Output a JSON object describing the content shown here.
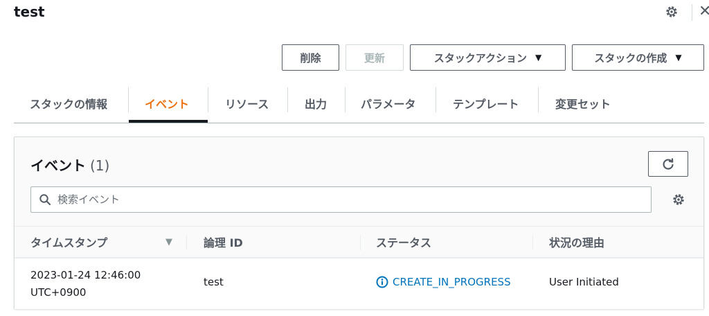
{
  "header": {
    "title": "test",
    "close_glyph": "✕"
  },
  "actions": {
    "delete": "削除",
    "update": "更新",
    "stack_actions": "スタックアクション",
    "create_stack": "スタックの作成"
  },
  "tabs": [
    {
      "label": "スタックの情報",
      "active": false
    },
    {
      "label": "イベント",
      "active": true
    },
    {
      "label": "リソース",
      "active": false
    },
    {
      "label": "出力",
      "active": false
    },
    {
      "label": "パラメータ",
      "active": false
    },
    {
      "label": "テンプレート",
      "active": false
    },
    {
      "label": "変更セット",
      "active": false
    }
  ],
  "events": {
    "title": "イベント",
    "count": "(1)",
    "search_placeholder": "検索イベント",
    "columns": [
      "タイムスタンプ",
      "論理 ID",
      "ステータス",
      "状況の理由"
    ],
    "rows": [
      {
        "timestamp_line1": "2023-01-24 12:46:00",
        "timestamp_line2": "UTC+0900",
        "logical_id": "test",
        "status": "CREATE_IN_PROGRESS",
        "reason": "User Initiated"
      }
    ]
  },
  "colors": {
    "accent": "#ec7211",
    "link": "#0073bb",
    "text": "#16191f",
    "muted": "#545b64"
  },
  "icons": [
    "gear-icon",
    "close-icon",
    "caret-down-icon",
    "refresh-icon",
    "search-icon",
    "sort-desc-icon",
    "info-icon"
  ]
}
